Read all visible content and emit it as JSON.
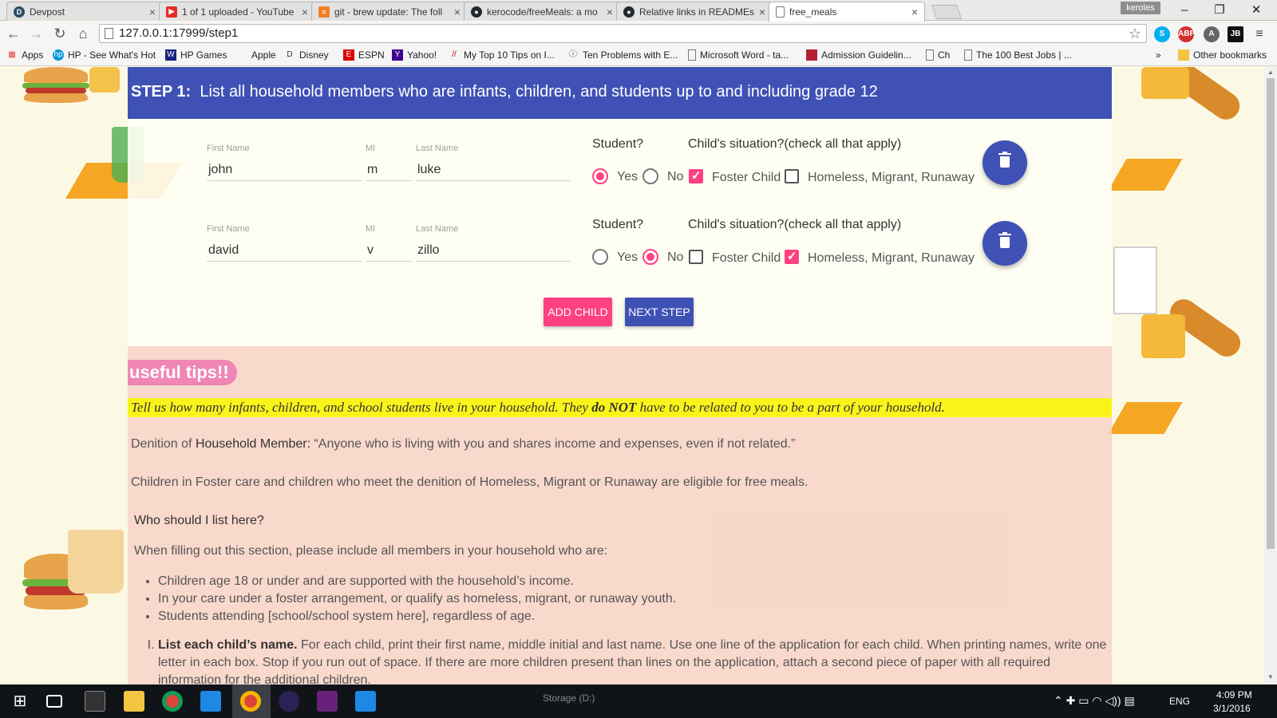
{
  "browser": {
    "tabs": [
      {
        "title": "Devpost",
        "icon": "devpost-icon",
        "icon_glyph": "D",
        "color": "#2d4d63"
      },
      {
        "title": "1 of 1 uploaded - YouTube",
        "icon": "youtube-icon",
        "icon_glyph": "▶",
        "color": "#e52d27"
      },
      {
        "title": "git - brew update: The foll",
        "icon": "stackoverflow-icon",
        "icon_glyph": "≡",
        "color": "#f48024"
      },
      {
        "title": "kerocode/freeMeals: a mo",
        "icon": "github-icon",
        "icon_glyph": "●",
        "color": "#24292e"
      },
      {
        "title": "Relative links in READMEs",
        "icon": "github-icon",
        "icon_glyph": "●",
        "color": "#24292e"
      },
      {
        "title": "free_meals",
        "icon": "page-icon",
        "icon_glyph": "",
        "color": "#ffffff"
      }
    ],
    "user": "keroles",
    "url": "127.0.0.1:17999/step1",
    "bookmarks": [
      "Apps",
      "HP - See What's Hot",
      "HP Games",
      "Apple",
      "Disney",
      "ESPN",
      "Yahoo!",
      "My Top 10 Tips on I...",
      "Ten Problems with E...",
      "Microsoft Word - ta...",
      "Admission Guidelin...",
      "Ch",
      "The 100 Best Jobs | ..."
    ],
    "bookmarks_more": "»",
    "other_bookmarks": "Other bookmarks"
  },
  "step": {
    "label": "STEP 1:",
    "title": "List all household members who are infants, children, and students up to and including grade 12"
  },
  "form": {
    "first_name_label": "First Name",
    "mi_label": "MI",
    "last_name_label": "Last Name",
    "student_question": "Student?",
    "yes_label": "Yes",
    "no_label": "No",
    "situation_question": "Child's situation?(check all that apply)",
    "foster_label": "Foster Child",
    "homeless_label": "Homeless, Migrant, Runaway",
    "children": [
      {
        "first": "john",
        "mi": "m",
        "last": "luke",
        "student": "yes",
        "foster": true,
        "homeless": false
      },
      {
        "first": "david",
        "mi": "v",
        "last": "zillo",
        "student": "no",
        "foster": false,
        "homeless": true
      }
    ],
    "add_child": "ADD CHILD",
    "next_step": "NEXT STEP"
  },
  "tips": {
    "badge": "useful tips!!",
    "highlight_pre": "Tell us how many infants, children, and school students live in your household. They ",
    "highlight_bold": "do NOT",
    "highlight_post": " have to be related to you to be a part of your household.",
    "definition_pre": "Denition of ",
    "definition_term": "Household Member:",
    "definition_text": " “Anyone who is living with you and shares income and expenses, even if not related.”",
    "foster_note": "Children in Foster care and children who meet the denition of Homeless, Migrant or Runaway are eligible for free meals.",
    "who_heading": "Who should I list here?",
    "who_intro": "When filling out this section, please include all members in your household who are:",
    "bullets": [
      "Children age 18 or under and are supported with the household’s income.",
      "In your care under a foster arrangement, or qualify as homeless, migrant, or runaway youth.",
      "Students attending [school/school system here], regardless of age."
    ],
    "step_i_bold": "List each child’s name.",
    "step_i_text": " For each child, print their first name, middle initial and last name. Use one line of the application for each child. When printing names, write one letter in each box. Stop if you run out of space. If there are more children present than lines on the application, attach a second piece of paper with all required information for the additional children."
  },
  "taskbar": {
    "storage": "Storage (D:)",
    "language": "ENG",
    "time": "4:09 PM",
    "date": "3/1/2016"
  },
  "colors": {
    "primary": "#3f51b5",
    "accent": "#ff4081",
    "highlight": "#fbf41b",
    "tips_bg": "#f8d4c8",
    "page_bg": "#fbf9e3"
  }
}
